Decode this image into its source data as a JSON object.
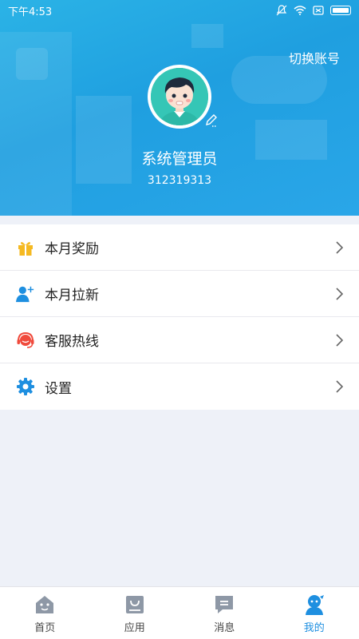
{
  "status_bar": {
    "time": "下午4:53"
  },
  "header": {
    "switch_account": "切换账号",
    "username": "系统管理员",
    "user_id": "312319313"
  },
  "menu": {
    "items": [
      {
        "label": "本月奖励",
        "icon": "gift-icon"
      },
      {
        "label": "本月拉新",
        "icon": "add-user-icon"
      },
      {
        "label": "客服热线",
        "icon": "headset-icon"
      },
      {
        "label": "设置",
        "icon": "gear-icon"
      }
    ]
  },
  "tabbar": {
    "tabs": [
      {
        "label": "首页",
        "icon": "home-icon"
      },
      {
        "label": "应用",
        "icon": "apps-bag-icon"
      },
      {
        "label": "消息",
        "icon": "message-icon"
      },
      {
        "label": "我的",
        "icon": "profile-icon",
        "active": true
      }
    ]
  },
  "colors": {
    "header_blue": "#1f9fe0",
    "accent_blue": "#1e8fe0",
    "gift_yellow": "#f5b921",
    "headset_red": "#f04a3c",
    "tab_icon_gray": "#8e98a6",
    "background": "#eef1f8"
  }
}
